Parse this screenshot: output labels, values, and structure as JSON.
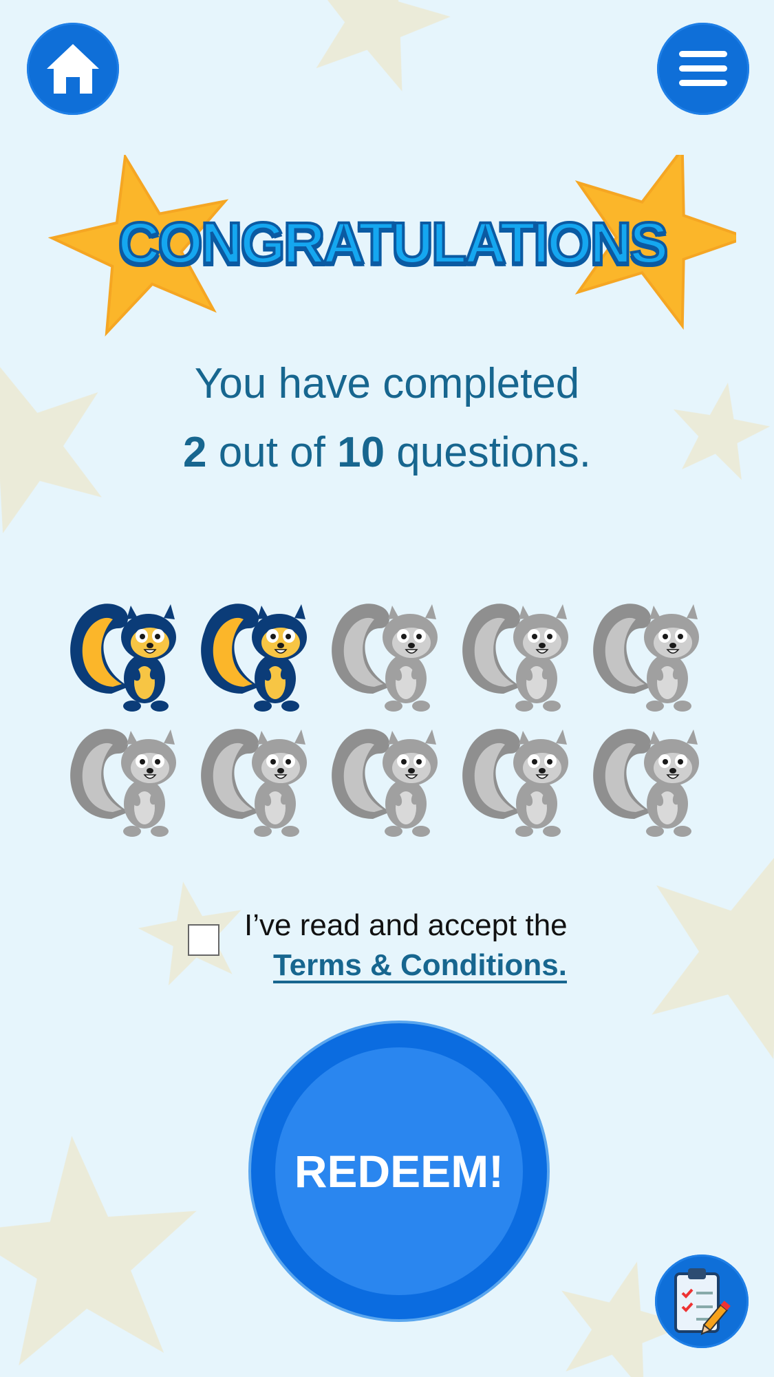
{
  "header": {
    "home_icon": "home-icon",
    "menu_icon": "hamburger-menu-icon"
  },
  "title": "CONGRATULATIONS",
  "progress": {
    "prefix": "You have completed",
    "completed": "2",
    "middle": " out of ",
    "total": "10",
    "suffix": " questions.",
    "completed_count": 2,
    "total_count": 10
  },
  "terms": {
    "text": "I’ve read and accept the",
    "link": "Terms & Conditions.",
    "checked": false
  },
  "redeem_label": "REDEEM!",
  "footer": {
    "clipboard_icon": "clipboard-checklist-icon"
  },
  "colors": {
    "background": "#e6f5fc",
    "primary_blue": "#0f6fd8",
    "text_blue": "#17668f",
    "star_yellow": "#fbb62a",
    "squirrel_navy": "#0b3c78",
    "squirrel_gray": "#9a9a9a"
  }
}
